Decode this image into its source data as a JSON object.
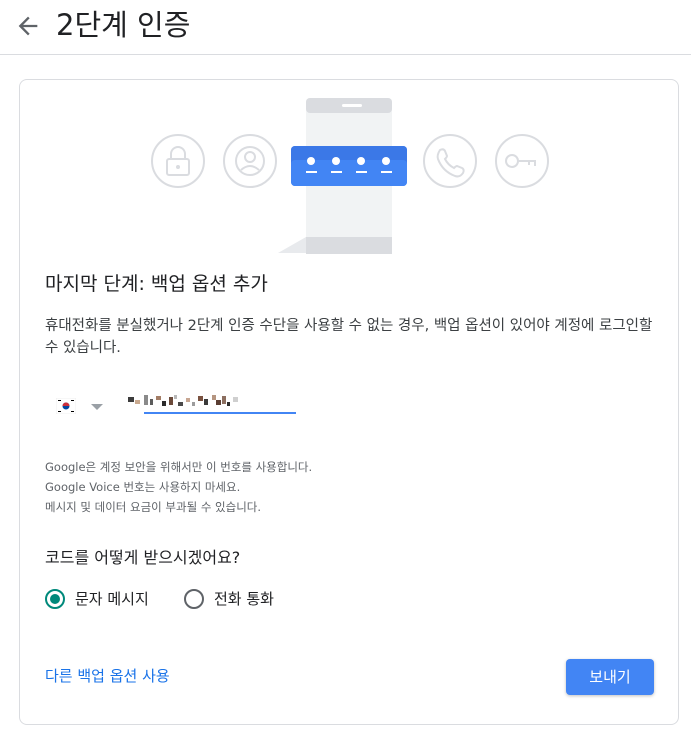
{
  "header": {
    "title": "2단계 인증"
  },
  "card": {
    "step_title": "마지막 단계: 백업 옵션 추가",
    "description": "휴대전화를 분실했거나 2단계 인증 수단을 사용할 수 없는 경우, 백업 옵션이 있어야 계정에 로그인할 수 있습니다.",
    "notes": [
      "Google은 계정 보안을 위해서만 이 번호를 사용합니다.",
      "Google Voice 번호는 사용하지 마세요.",
      "메시지 및 데이터 요금이 부과될 수 있습니다."
    ],
    "question": "코드를 어떻게 받으시겠어요?",
    "options": {
      "sms": "문자 메시지",
      "call": "전화 통화"
    },
    "selected_option": "sms",
    "alt_link": "다른 백업 옵션 사용",
    "send_button": "보내기"
  },
  "icons": {
    "back": "arrow-back-icon",
    "lock": "lock-icon",
    "account": "account-circle-icon",
    "phone": "phone-icon",
    "key": "key-icon",
    "flag": "south-korea-flag-icon"
  },
  "colors": {
    "accent": "#4285f4",
    "radio_selected": "#00897b",
    "link": "#1a73e8"
  }
}
